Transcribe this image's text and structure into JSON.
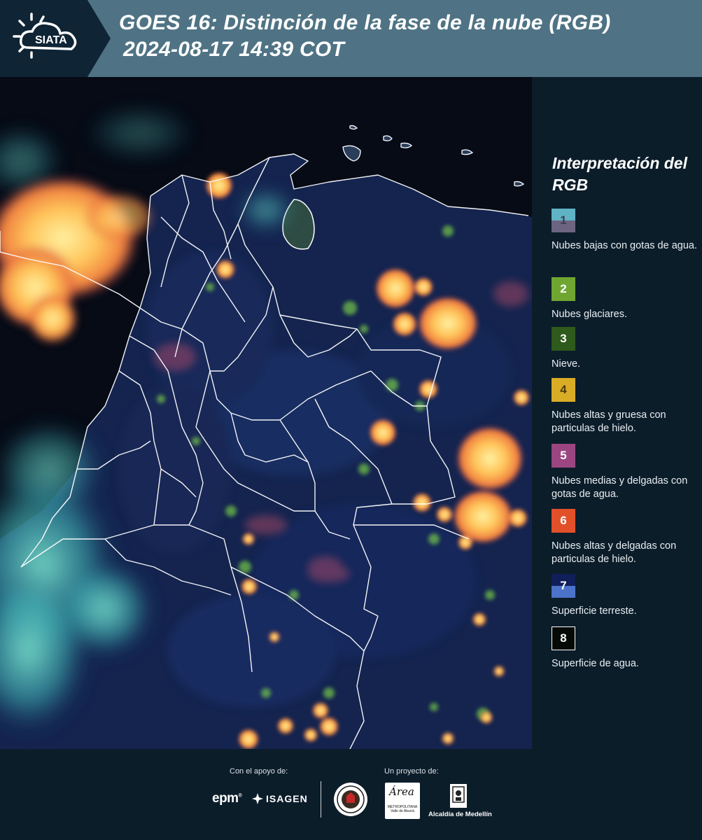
{
  "header": {
    "title_line1": "GOES 16: Distinción de la fase de la nube (RGB)",
    "title_line2": "2024-08-17 14:39 COT",
    "logo_text": "SIATA",
    "background_color": "#4f7385"
  },
  "legend": {
    "title": "Interpretación del RGB",
    "items": [
      {
        "number": "1",
        "label": "Nubes bajas con gotas de agua.",
        "color_top": "#5fb3c4",
        "color_bottom": "#6c6480",
        "number_color": "#3d3e52"
      },
      {
        "number": "2",
        "label": "Nubes glaciares.",
        "color_top": "#6fa631",
        "color_bottom": "#6fa631",
        "number_color": "#ffffff"
      },
      {
        "number": "3",
        "label": "Nieve.",
        "color_top": "#2e5a1c",
        "color_bottom": "#2e5a1c",
        "number_color": "#ffffff"
      },
      {
        "number": "4",
        "label": "Nubes altas y gruesa con particulas de hielo.",
        "color_top": "#d9ac26",
        "color_bottom": "#d9ac26",
        "number_color": "#4a3a10"
      },
      {
        "number": "5",
        "label": "Nubes medias y delgadas con gotas de agua.",
        "color_top": "#9b4680",
        "color_bottom": "#9b4680",
        "number_color": "#ffffff"
      },
      {
        "number": "6",
        "label": "Nubes altas y delgadas con particulas de hielo.",
        "color_top": "#e2502a",
        "color_bottom": "#e2502a",
        "number_color": "#ffffff"
      },
      {
        "number": "7",
        "label": "Superficie terreste.",
        "color_top": "#101e5a",
        "color_bottom": "#4b73c9",
        "number_color": "#ffffff"
      },
      {
        "number": "8",
        "label": "Superficie de agua.",
        "color_top": "#050a06",
        "color_bottom": "#050a06",
        "number_color": "#ffffff"
      }
    ]
  },
  "footer": {
    "support_label": "Con el apoyo de:",
    "project_label": "Un proyecto de:",
    "epm": "epm",
    "isagen": "ISAGEN",
    "area_logo": "Área",
    "area_subtitle": "METROPOLITANA Valle de Aburrá",
    "medellin": "Alcaldía de Medellín"
  }
}
